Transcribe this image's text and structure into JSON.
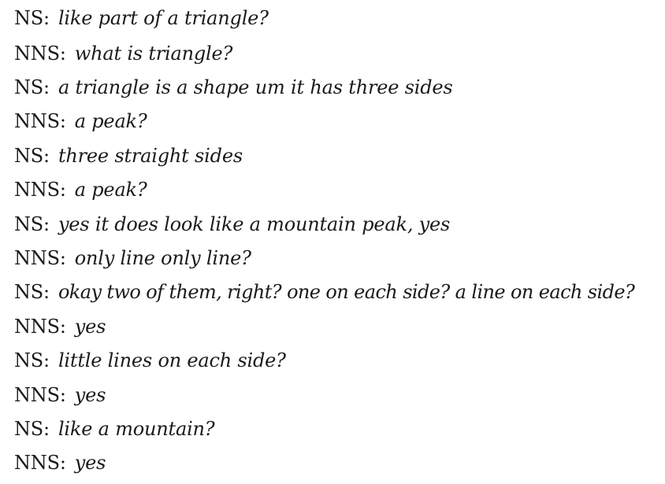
{
  "transcript": {
    "turns": [
      {
        "speaker": "NS:",
        "text": "like part of a triangle?"
      },
      {
        "speaker": "NNS:",
        "text": "what is triangle?"
      },
      {
        "speaker": "NS:",
        "text": "a triangle is a shape um it has three sides"
      },
      {
        "speaker": "NNS:",
        "text": "a peak?"
      },
      {
        "speaker": "NS:",
        "text": "three straight sides"
      },
      {
        "speaker": "NNS:",
        "text": "a peak?"
      },
      {
        "speaker": "NS:",
        "text": "yes it does look like a mountain peak, yes"
      },
      {
        "speaker": "NNS:",
        "text": "only line only line?"
      },
      {
        "speaker": "NS:",
        "text": "okay two of them, right? one on each side? a line on each side?"
      },
      {
        "speaker": "NNS:",
        "text": "yes"
      },
      {
        "speaker": "NS:",
        "text": "little lines on each side?"
      },
      {
        "speaker": "NNS:",
        "text": "yes"
      },
      {
        "speaker": "NS:",
        "text": "like a mountain?"
      },
      {
        "speaker": "NNS:",
        "text": "yes"
      }
    ]
  }
}
